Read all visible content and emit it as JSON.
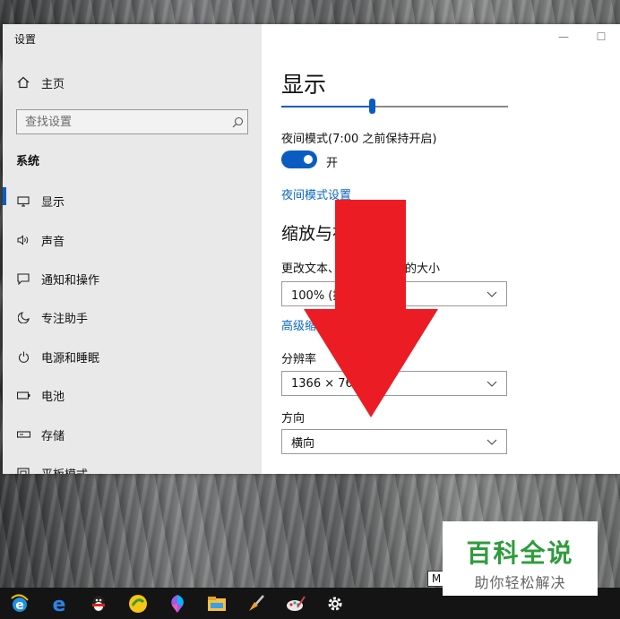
{
  "window": {
    "title": "设置",
    "minimize_glyph": "—",
    "maximize_glyph": "☐"
  },
  "sidebar": {
    "home_label": "主页",
    "search_placeholder": "查找设置",
    "section_heading": "系统",
    "items": [
      {
        "label": "显示",
        "icon": "monitor-icon",
        "active": true
      },
      {
        "label": "声音",
        "icon": "speaker-icon",
        "active": false
      },
      {
        "label": "通知和操作",
        "icon": "notification-icon",
        "active": false
      },
      {
        "label": "专注助手",
        "icon": "moon-icon",
        "active": false
      },
      {
        "label": "电源和睡眠",
        "icon": "power-icon",
        "active": false
      },
      {
        "label": "电池",
        "icon": "battery-icon",
        "active": false
      },
      {
        "label": "存储",
        "icon": "storage-icon",
        "active": false
      },
      {
        "label": "平板模式",
        "icon": "tablet-icon",
        "active": false
      }
    ]
  },
  "content": {
    "title": "显示",
    "brightness_level": 0.4,
    "night_mode_label": "夜间模式(7:00 之前保持开启)",
    "night_toggle_text": "开",
    "night_toggle_on": true,
    "night_settings_link": "夜间模式设置",
    "scale_section_title": "缩放与布",
    "scale_label": "更改文本、",
    "scale_label_tail": "的大小",
    "scale_value": "100% (推",
    "advanced_link": "高级缩",
    "resolution_label": "分辨率",
    "resolution_value": "1366 × 768",
    "orientation_label": "方向",
    "orientation_value": "横向"
  },
  "colors": {
    "accent": "#0a5cc2",
    "link": "#0a66c2",
    "overlay_arrow": "#ec1c24",
    "watermark_green": "#2f9c3c"
  },
  "taskbar": {
    "icons": [
      "ie-icon",
      "edge-icon",
      "qq-icon",
      "browser-icon",
      "paint3d-icon",
      "file-explorer-icon",
      "cleaner-icon",
      "paint-icon",
      "settings-gear-icon"
    ]
  },
  "watermark": {
    "title": "百科全说",
    "subtitle": "助你轻松解决",
    "fragment": "M"
  }
}
